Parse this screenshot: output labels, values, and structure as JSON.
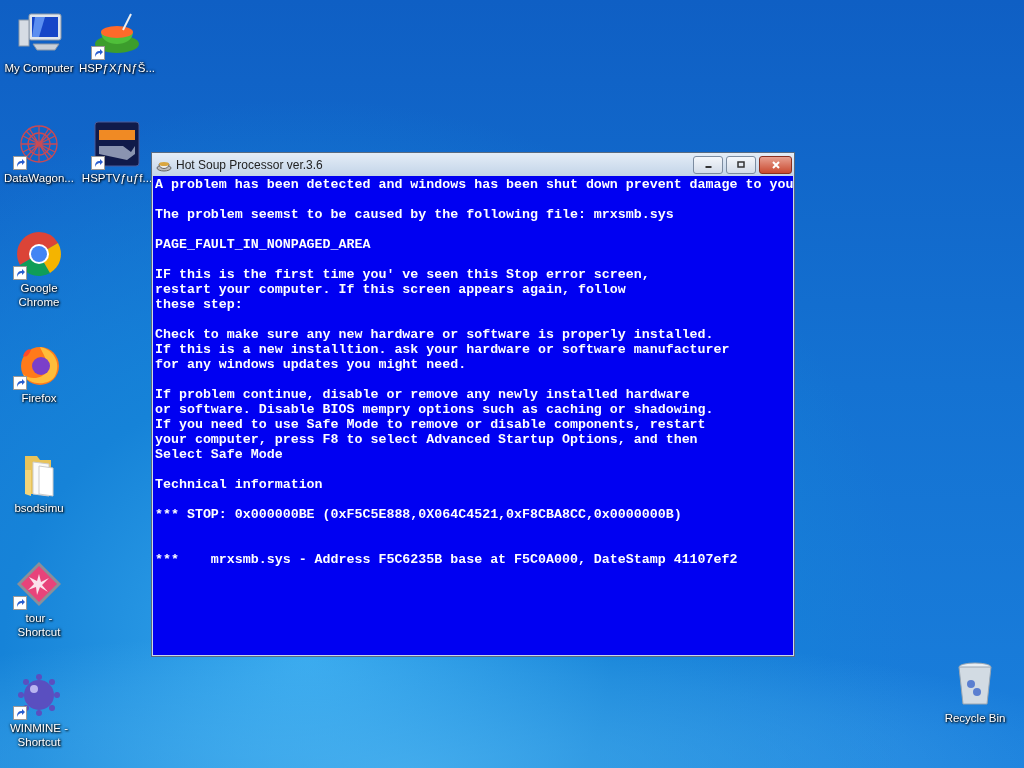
{
  "desktop_icons": [
    {
      "label": "My Computer",
      "kind": "computer",
      "shortcut": false
    },
    {
      "label": "DataWagon...",
      "kind": "network",
      "shortcut": true
    },
    {
      "label": "Google Chrome",
      "kind": "chrome",
      "shortcut": true
    },
    {
      "label": "Firefox",
      "kind": "firefox",
      "shortcut": true
    },
    {
      "label": "bsodsimu",
      "kind": "folder",
      "shortcut": false
    },
    {
      "label": "tour - Shortcut",
      "kind": "tour",
      "shortcut": true
    },
    {
      "label": "WINMINE - Shortcut",
      "kind": "mine",
      "shortcut": true
    },
    {
      "label": "HSPƒXƒNƒŠ...",
      "kind": "teacup",
      "shortcut": true
    },
    {
      "label": "HSPTVƒuƒf...",
      "kind": "hsp",
      "shortcut": true
    }
  ],
  "recycle_bin": {
    "label": "Recycle Bin",
    "kind": "bin",
    "shortcut": false
  },
  "window": {
    "title": "Hot Soup Processor ver.3.6",
    "paragraphs": [
      {
        "kind": "text",
        "lines": [
          "A problem has been detected and windows has been shut down prevent damage to you"
        ]
      },
      {
        "kind": "text",
        "lines": [
          "The problem seemst to be caused by the following file: mrxsmb.sys"
        ]
      },
      {
        "kind": "text",
        "lines": [
          "PAGE_FAULT_IN_NONPAGED_AREA"
        ]
      },
      {
        "kind": "text",
        "lines": [
          "IF this is the first time you' ve seen this Stop error screen,",
          "restart your computer. If this screen appears again, follow",
          "these step:"
        ]
      },
      {
        "kind": "text",
        "lines": [
          "Check to make sure any new hardware or software is properly installed.",
          "If this is a new installtion. ask your hardware or software manufacturer",
          "for any windows updates you might need."
        ]
      },
      {
        "kind": "text",
        "lines": [
          "If problem continue, disable or remove any newly installed hardware",
          "or software. Disable BIOS mempry options such as caching or shadowing.",
          "If you need to use Safe Mode to remove or disable components, restart",
          "your computer, press F8 to select Advanced Startup Options, and then",
          "Select Safe Mode"
        ]
      },
      {
        "kind": "text",
        "lines": [
          "Technical information"
        ]
      },
      {
        "kind": "text",
        "lines": [
          "*** STOP: 0x000000BE (0xF5C5E888,0X064C4521,0xF8CBA8CC,0x0000000B)"
        ]
      },
      {
        "kind": "module",
        "lines": [
          "***    mrxsmb.sys - Address F5C6235B base at F5C0A000, DateStamp 41107ef2"
        ]
      }
    ]
  }
}
